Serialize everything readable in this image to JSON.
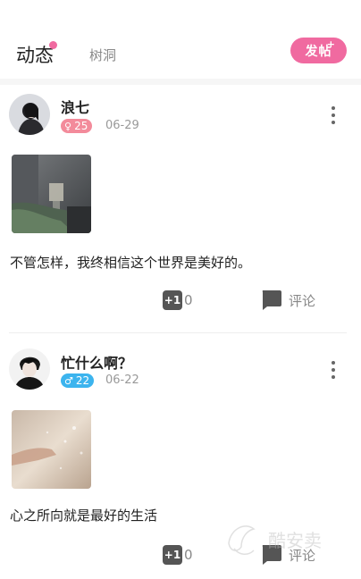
{
  "header": {
    "tab_active": "动态",
    "tab_inactive": "树洞",
    "post_button": "发帖",
    "post_button_plus": "+"
  },
  "posts": [
    {
      "username": "浪七",
      "badge_value": "25",
      "badge_symbol": "♀",
      "badge_color": "#f38b9b",
      "date": "06-29",
      "text": "不管怎样，我终相信这个世界是美好的。",
      "like_icon": "+1",
      "like_count": "0",
      "comment_label": "评论"
    },
    {
      "username": "忙什么啊？",
      "badge_value": "22",
      "badge_symbol": "♂",
      "badge_color": "#3cb4ee",
      "date": "06-22",
      "text": "心之所向就是最好的生活",
      "like_icon": "+1",
      "like_count": "0",
      "comment_label": "评论"
    }
  ],
  "watermark": {
    "text": "酷安卖"
  },
  "colors": {
    "accent": "#f06aa0",
    "icon_dark": "#555555"
  },
  "icons": [
    "more-vertical-icon",
    "plus-one-icon",
    "comment-bubble-icon"
  ]
}
